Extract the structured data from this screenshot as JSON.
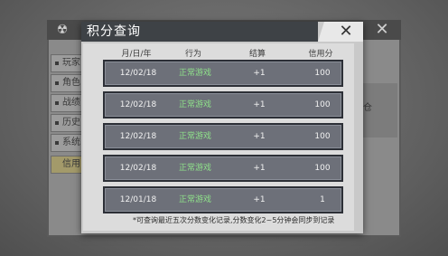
{
  "background": {
    "sidebar_items": [
      "玩家",
      "角色",
      "战绩",
      "历史",
      "系统",
      "信用"
    ],
    "right_label": "仓"
  },
  "dialog": {
    "title": "积分查询",
    "close_glyph": "✕",
    "columns": [
      "月/日/年",
      "行为",
      "结算",
      "信用分"
    ],
    "rows": [
      {
        "date": "12/02/18",
        "action": "正常游戏",
        "settlement": "+1",
        "credit": "100"
      },
      {
        "date": "12/02/18",
        "action": "正常游戏",
        "settlement": "+1",
        "credit": "100"
      },
      {
        "date": "12/02/18",
        "action": "正常游戏",
        "settlement": "+1",
        "credit": "100"
      },
      {
        "date": "12/02/18",
        "action": "正常游戏",
        "settlement": "+1",
        "credit": "100"
      },
      {
        "date": "12/01/18",
        "action": "正常游戏",
        "settlement": "+1",
        "credit": "1"
      }
    ],
    "footer_note": "*可查询最近五次分数变化记录,分数变化2~5分钟会同步到记录"
  },
  "colors": {
    "title_bar": "#3e4246",
    "row_bg": "#6d7079",
    "action_green": "#8fe28a"
  }
}
